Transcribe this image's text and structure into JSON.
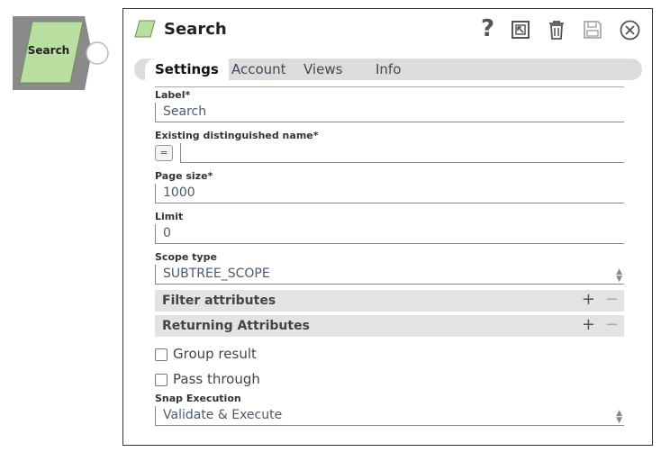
{
  "snap": {
    "label": "Search"
  },
  "dialog": {
    "title": "Search"
  },
  "tabs": [
    "Settings",
    "Account",
    "Views",
    "Info"
  ],
  "fields": {
    "label": {
      "label": "Label*",
      "value": "Search"
    },
    "dn": {
      "label": "Existing distinguished name*",
      "value": "",
      "expr_symbol": "="
    },
    "page_size": {
      "label": "Page size*",
      "value": "1000"
    },
    "limit": {
      "label": "Limit",
      "value": "0"
    },
    "scope_type": {
      "label": "Scope type",
      "value": "SUBTREE_SCOPE"
    },
    "snap_execution": {
      "label": "Snap Execution",
      "value": "Validate & Execute"
    }
  },
  "sections": {
    "filter": {
      "title": "Filter attributes",
      "add": "+",
      "remove": "−"
    },
    "returning": {
      "title": "Returning Attributes",
      "add": "+",
      "remove": "−"
    }
  },
  "checkboxes": {
    "group_result": {
      "label": "Group result",
      "checked": false
    },
    "pass_through": {
      "label": "Pass through",
      "checked": false
    }
  },
  "header_buttons": [
    "help-icon",
    "export-icon",
    "delete-icon",
    "save-icon",
    "close-icon"
  ],
  "colors": {
    "snap_green": "#b9dfa0",
    "snap_gray": "#8a8a8a",
    "tab_bg": "#dcdcdc"
  }
}
